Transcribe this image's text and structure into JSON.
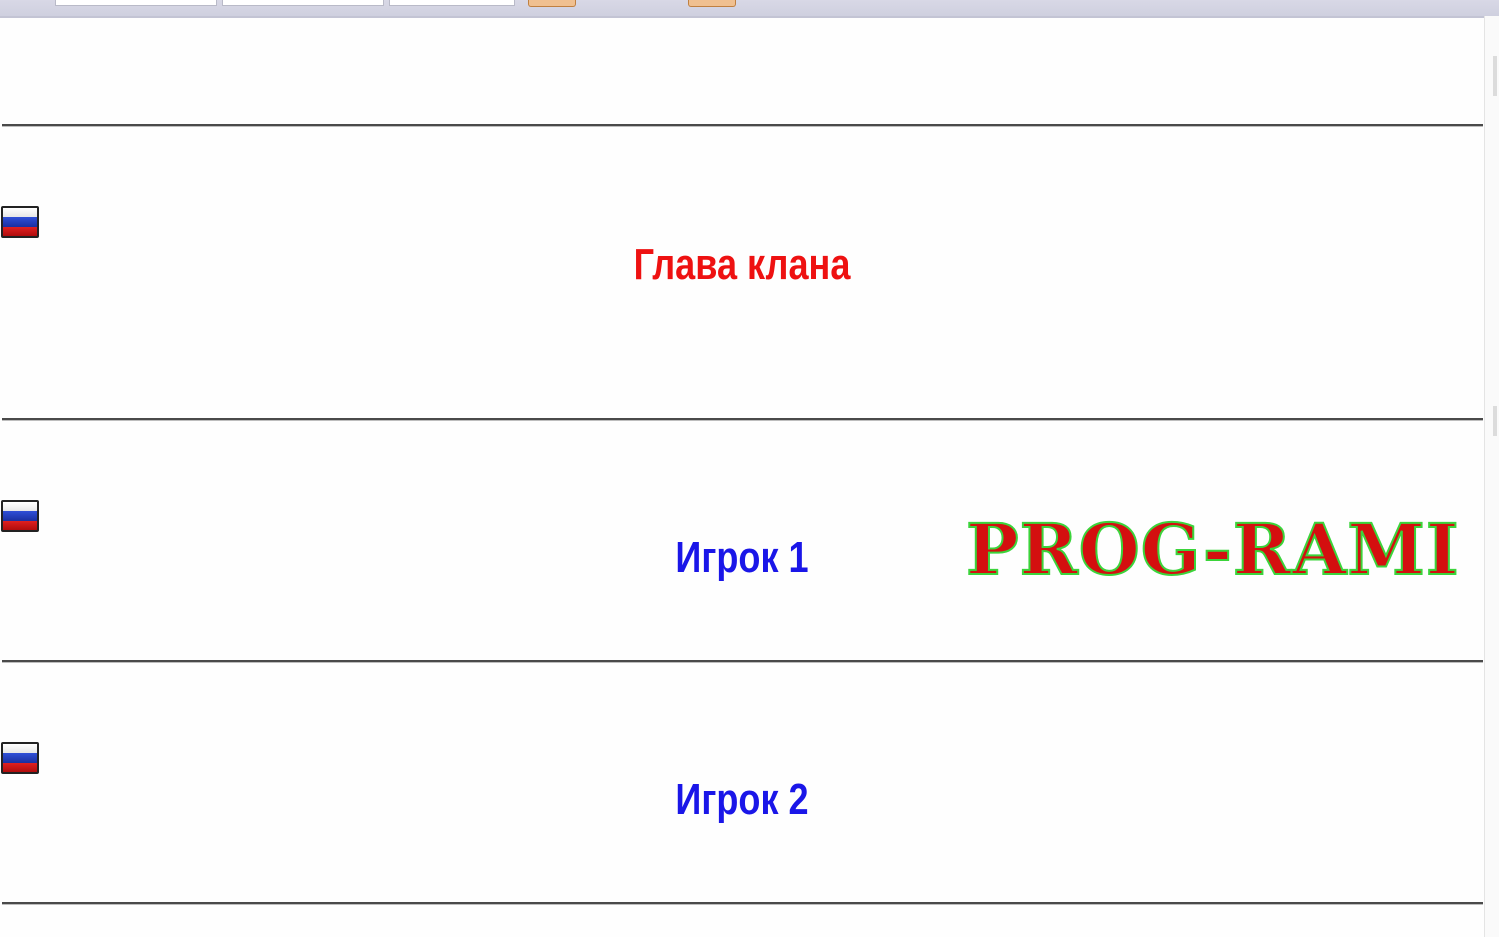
{
  "players": [
    {
      "name": "Глава клана",
      "role": "leader",
      "color": "#ee1111",
      "flag_icon": "russia-flag-icon"
    },
    {
      "name": "Игрок 1",
      "role": "member",
      "color": "#1a16e8",
      "flag_icon": "russia-flag-icon"
    },
    {
      "name": "Игрок 2",
      "role": "member",
      "color": "#1a16e8",
      "flag_icon": "russia-flag-icon"
    }
  ],
  "watermark": {
    "text": "PROG-RAMI",
    "fill_color": "#d40f0f",
    "outline_color": "#3bd43b"
  },
  "toolbar": {
    "button_color": "#f0c090"
  }
}
